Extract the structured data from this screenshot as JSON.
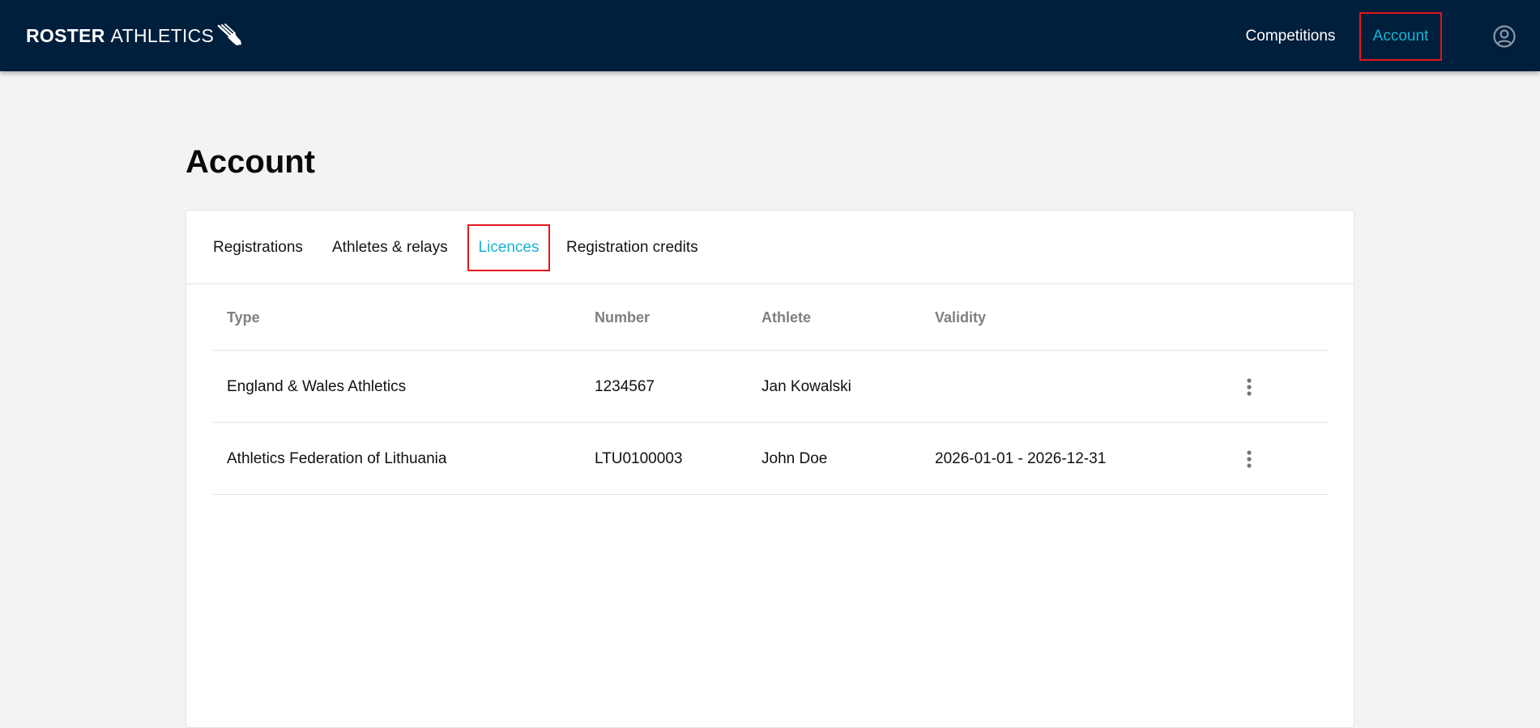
{
  "header": {
    "brand_bold": "ROSTER",
    "brand_light": "ATHLETICS",
    "brand_icon": "winged-shoe-icon",
    "nav": {
      "competitions": "Competitions",
      "account": "Account"
    },
    "user_icon": "user-circle-icon"
  },
  "colors": {
    "topbar_bg": "#001f3d",
    "accent": "#19b3d3",
    "highlight_border": "#e3161d",
    "page_bg": "#f3f3f3"
  },
  "page": {
    "title": "Account"
  },
  "tabs": [
    {
      "label": "Registrations",
      "active": false
    },
    {
      "label": "Athletes & relays",
      "active": false
    },
    {
      "label": "Licences",
      "active": true
    },
    {
      "label": "Registration credits",
      "active": false
    }
  ],
  "table": {
    "columns": [
      "Type",
      "Number",
      "Athlete",
      "Validity"
    ],
    "rows": [
      {
        "type": "England & Wales Athletics",
        "number": "1234567",
        "athlete": "Jan Kowalski",
        "validity": ""
      },
      {
        "type": "Athletics Federation of Lithuania",
        "number": "LTU0100003",
        "athlete": "John Doe",
        "validity": "2026-01-01 - 2026-12-31"
      }
    ],
    "row_menu_icon": "more-vertical-icon"
  }
}
